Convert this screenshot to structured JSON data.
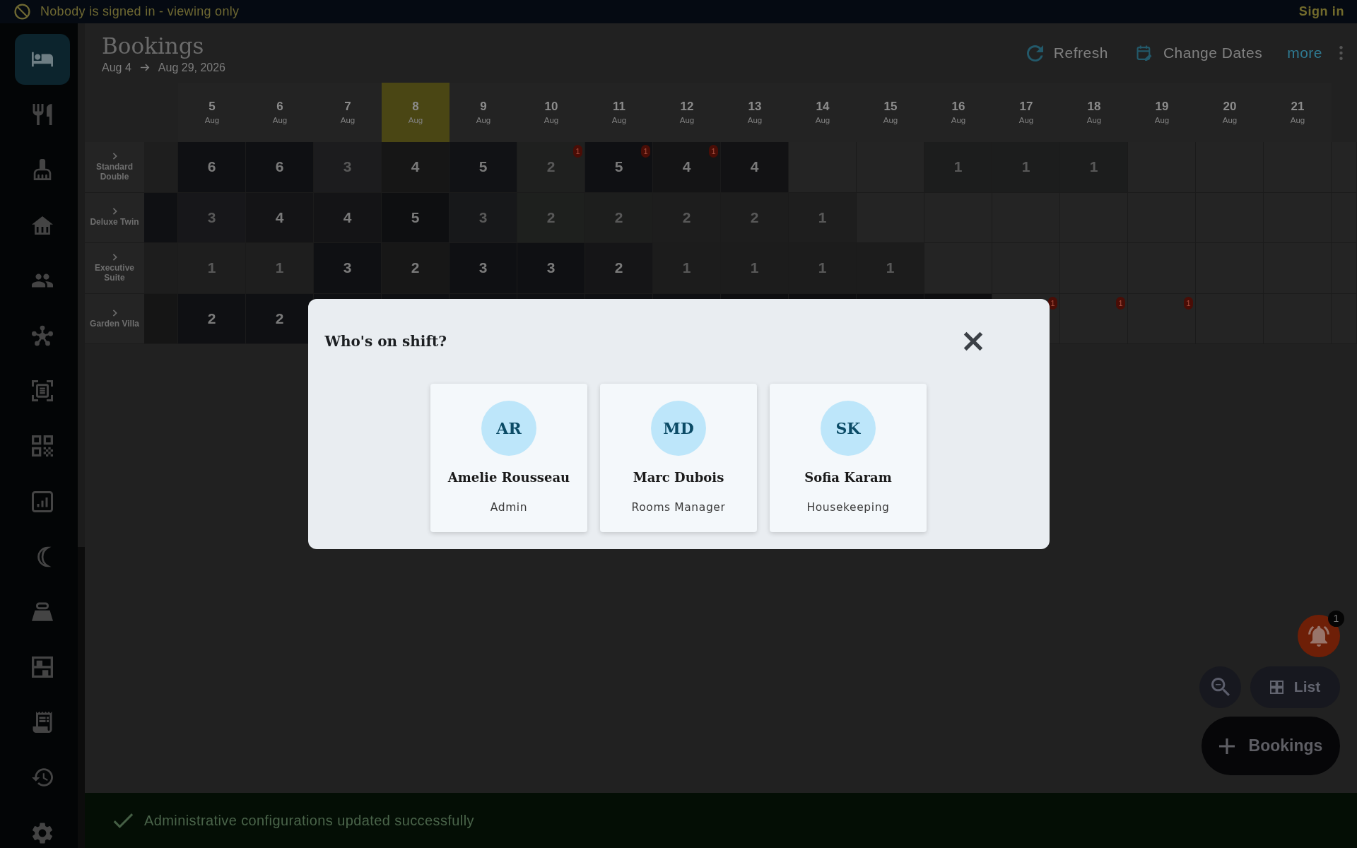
{
  "top_bar": {
    "message": "Nobody is signed in - viewing only",
    "sign_in": "Sign in"
  },
  "sidebar": {
    "items": [
      {
        "selected": true
      },
      {
        "selected": false
      },
      {
        "selected": false
      },
      {
        "selected": false
      },
      {
        "selected": false
      },
      {
        "selected": false
      },
      {
        "selected": false
      },
      {
        "selected": false
      },
      {
        "selected": false
      },
      {
        "selected": false
      },
      {
        "selected": false
      },
      {
        "selected": false
      },
      {
        "selected": false
      },
      {
        "selected": false
      },
      {
        "selected": false
      }
    ]
  },
  "header": {
    "title": "Bookings",
    "date_from": "Aug 4",
    "date_to": "Aug 29, 2026",
    "actions": [
      {
        "label": "Refresh"
      },
      {
        "label": "Change Dates"
      }
    ],
    "more": "more"
  },
  "grid": {
    "dates": [
      {
        "day": "5",
        "month": "Aug",
        "today": false
      },
      {
        "day": "6",
        "month": "Aug",
        "today": false
      },
      {
        "day": "7",
        "month": "Aug",
        "today": false
      },
      {
        "day": "8",
        "month": "Aug",
        "today": true
      },
      {
        "day": "9",
        "month": "Aug",
        "today": false
      },
      {
        "day": "10",
        "month": "Aug",
        "today": false
      },
      {
        "day": "11",
        "month": "Aug",
        "today": false
      },
      {
        "day": "12",
        "month": "Aug",
        "today": false
      },
      {
        "day": "13",
        "month": "Aug",
        "today": false
      },
      {
        "day": "14",
        "month": "Aug",
        "today": false
      },
      {
        "day": "15",
        "month": "Aug",
        "today": false
      },
      {
        "day": "16",
        "month": "Aug",
        "today": false
      },
      {
        "day": "17",
        "month": "Aug",
        "today": false
      },
      {
        "day": "18",
        "month": "Aug",
        "today": false
      },
      {
        "day": "19",
        "month": "Aug",
        "today": false
      },
      {
        "day": "20",
        "month": "Aug",
        "today": false
      },
      {
        "day": "21",
        "month": "Aug",
        "today": false
      }
    ],
    "rows": [
      {
        "label": "Standard Double",
        "expanded": false,
        "cells": [
          {
            "color": "#1e1e1e"
          },
          {
            "value": "6",
            "color": "#0f1013"
          },
          {
            "value": "6",
            "color": "#0f1013"
          },
          {
            "value": "3",
            "color": "#1c1c1e"
          },
          {
            "value": "4",
            "color": "#161616"
          },
          {
            "value": "5",
            "color": "#111215"
          },
          {
            "value": "2",
            "color": "#1f201f",
            "badge": "1"
          },
          {
            "value": "5",
            "color": "#0f1013",
            "badge": "1"
          },
          {
            "value": "4",
            "color": "#141415",
            "badge": "1"
          },
          {
            "value": "4",
            "color": "#121214"
          },
          {},
          {},
          {
            "value": "1",
            "color": "#1c1d1d"
          },
          {
            "value": "1",
            "color": "#1c1d1d"
          },
          {
            "value": "1",
            "color": "#1c1d1d"
          },
          {},
          {},
          {}
        ]
      },
      {
        "label": "Deluxe Twin",
        "expanded": false,
        "cells": [
          {
            "color": "#0f1013"
          },
          {
            "value": "3",
            "color": "#17171a"
          },
          {
            "value": "4",
            "color": "#141416"
          },
          {
            "value": "4",
            "color": "#141416"
          },
          {
            "value": "5",
            "color": "#0e0f11"
          },
          {
            "value": "3",
            "color": "#17181a"
          },
          {
            "value": "2",
            "color": "#1e201e"
          },
          {
            "value": "2",
            "color": "#1d1e1d"
          },
          {
            "value": "2",
            "color": "#1d1d1d"
          },
          {
            "value": "2",
            "color": "#1d1d1d"
          },
          {
            "value": "1",
            "color": "#1e1e1e"
          },
          {},
          {},
          {},
          {},
          {},
          {},
          {}
        ]
      },
      {
        "label": "Executive Suite",
        "expanded": false,
        "cells": [
          {
            "color": "#1d1d1d"
          },
          {
            "value": "1",
            "color": "#1e1e1e"
          },
          {
            "value": "1",
            "color": "#1e1e1e"
          },
          {
            "value": "3",
            "color": "#0f1013"
          },
          {
            "value": "2",
            "color": "#171717"
          },
          {
            "value": "3",
            "color": "#0f1013"
          },
          {
            "value": "3",
            "color": "#0f1013"
          },
          {
            "value": "2",
            "color": "#151517"
          },
          {
            "value": "1",
            "color": "#1c1c1c"
          },
          {
            "value": "1",
            "color": "#1c1c1c"
          },
          {
            "value": "1",
            "color": "#1c1c1c"
          },
          {
            "value": "1",
            "color": "#1c1c1c"
          },
          {},
          {},
          {},
          {},
          {},
          {}
        ]
      },
      {
        "label": "Garden Villa",
        "expanded": false,
        "cells": [
          {
            "color": "#151515"
          },
          {
            "value": "2",
            "color": "#0f1013"
          },
          {
            "value": "2",
            "color": "#0f1013"
          },
          {
            "color": "#0f1013"
          },
          {
            "color": "#0f1013"
          },
          {
            "color": "#0f1013"
          },
          {
            "color": "#0f1013"
          },
          {
            "color": "#0f1013"
          },
          {
            "color": "#0f1013"
          },
          {
            "color": "#0e0e10"
          },
          {
            "color": "#0e0e10"
          },
          {
            "color": "#0e0e10"
          },
          {
            "color": "#0e0e10"
          },
          {
            "badge": "1"
          },
          {
            "badge": "1"
          },
          {
            "badge": "1"
          },
          {},
          {}
        ]
      }
    ]
  },
  "notifications": {
    "count": "1"
  },
  "floating_actions": {
    "list": "List",
    "add": "Bookings"
  },
  "toast": {
    "message": "Administrative configurations updated successfully"
  },
  "dialog": {
    "title": "Who's on shift?",
    "staff": [
      {
        "initials": "AR",
        "name": "Amelie Rousseau",
        "role": "Admin"
      },
      {
        "initials": "MD",
        "name": "Marc Dubois",
        "role": "Rooms Manager"
      },
      {
        "initials": "SK",
        "name": "Sofia Karam",
        "role": "Housekeeping"
      }
    ]
  }
}
